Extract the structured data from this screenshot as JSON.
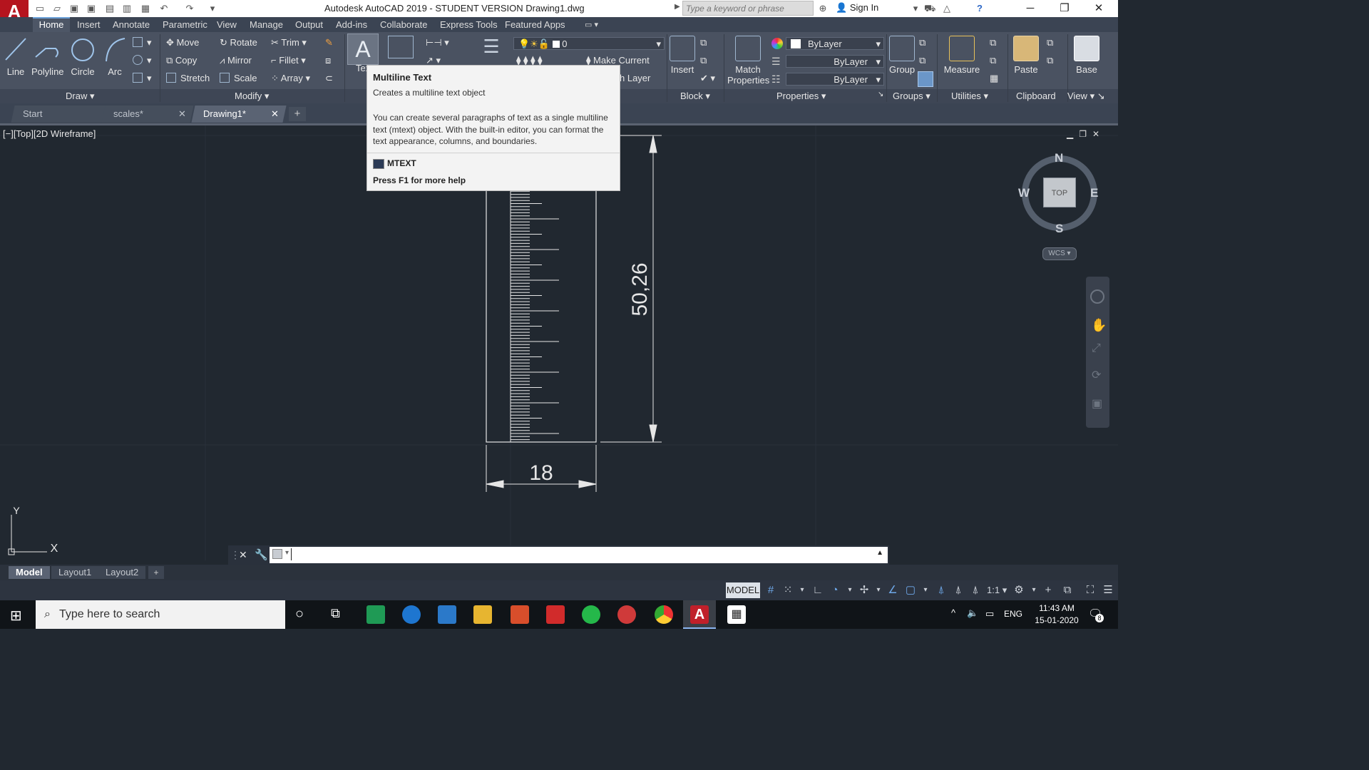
{
  "window": {
    "title": "Autodesk AutoCAD 2019 - STUDENT VERSION    Drawing1.dwg",
    "app_logo": "A",
    "search_placeholder": "Type a keyword or phrase",
    "sign_in": "Sign In"
  },
  "ribbon_tabs": [
    "Home",
    "Insert",
    "Annotate",
    "Parametric",
    "View",
    "Manage",
    "Output",
    "Add-ins",
    "Collaborate",
    "Express Tools",
    "Featured Apps"
  ],
  "ribbon": {
    "draw": {
      "line": "Line",
      "polyline": "Polyline",
      "circle": "Circle",
      "arc": "Arc",
      "label": "Draw"
    },
    "modify": {
      "move": "Move",
      "rotate": "Rotate",
      "trim": "Trim",
      "copy": "Copy",
      "mirror": "Mirror",
      "fillet": "Fillet",
      "stretch": "Stretch",
      "scale": "Scale",
      "array": "Array",
      "label": "Modify"
    },
    "annotation": {
      "text_partial": "Tex"
    },
    "layers": {
      "current_layer": "0",
      "make_current": "Make Current",
      "match_layer_partial": "h Layer"
    },
    "block": {
      "insert": "Insert",
      "label": "Block"
    },
    "properties": {
      "match": "Match",
      "match2": "Properties",
      "color": "ByLayer",
      "linetype": "ByLayer",
      "lineweight": "ByLayer",
      "label": "Properties"
    },
    "groups": {
      "group": "Group",
      "label": "Groups"
    },
    "utilities": {
      "measure": "Measure",
      "label": "Utilities"
    },
    "clipboard": {
      "paste": "Paste",
      "label": "Clipboard"
    },
    "view": {
      "base": "Base",
      "label": "View"
    }
  },
  "file_tabs": [
    "Start",
    "scales*",
    "Drawing1*"
  ],
  "viewport_label": "[−][Top][2D Wireframe]",
  "tooltip": {
    "title": "Multiline Text",
    "subtitle": "Creates a multiline text object",
    "description": "You can create several paragraphs of text as a single multiline text (mtext) object. With the built-in editor, you can format the text appearance, columns, and boundaries.",
    "command": "MTEXT",
    "help": "Press F1 for more help"
  },
  "drawing": {
    "dim_vertical": "50,26",
    "dim_horizontal": "18"
  },
  "viewcube": {
    "top": "TOP",
    "n": "N",
    "s": "S",
    "e": "E",
    "w": "W",
    "wcs": "WCS"
  },
  "ucs": {
    "x": "X",
    "y": "Y"
  },
  "layout_tabs": [
    "Model",
    "Layout1",
    "Layout2"
  ],
  "status": {
    "model": "MODEL",
    "scale": "1:1"
  },
  "taskbar": {
    "search": "Type here to search",
    "lang": "ENG",
    "time": "11:43 AM",
    "date": "15-01-2020",
    "notifications": "8"
  }
}
